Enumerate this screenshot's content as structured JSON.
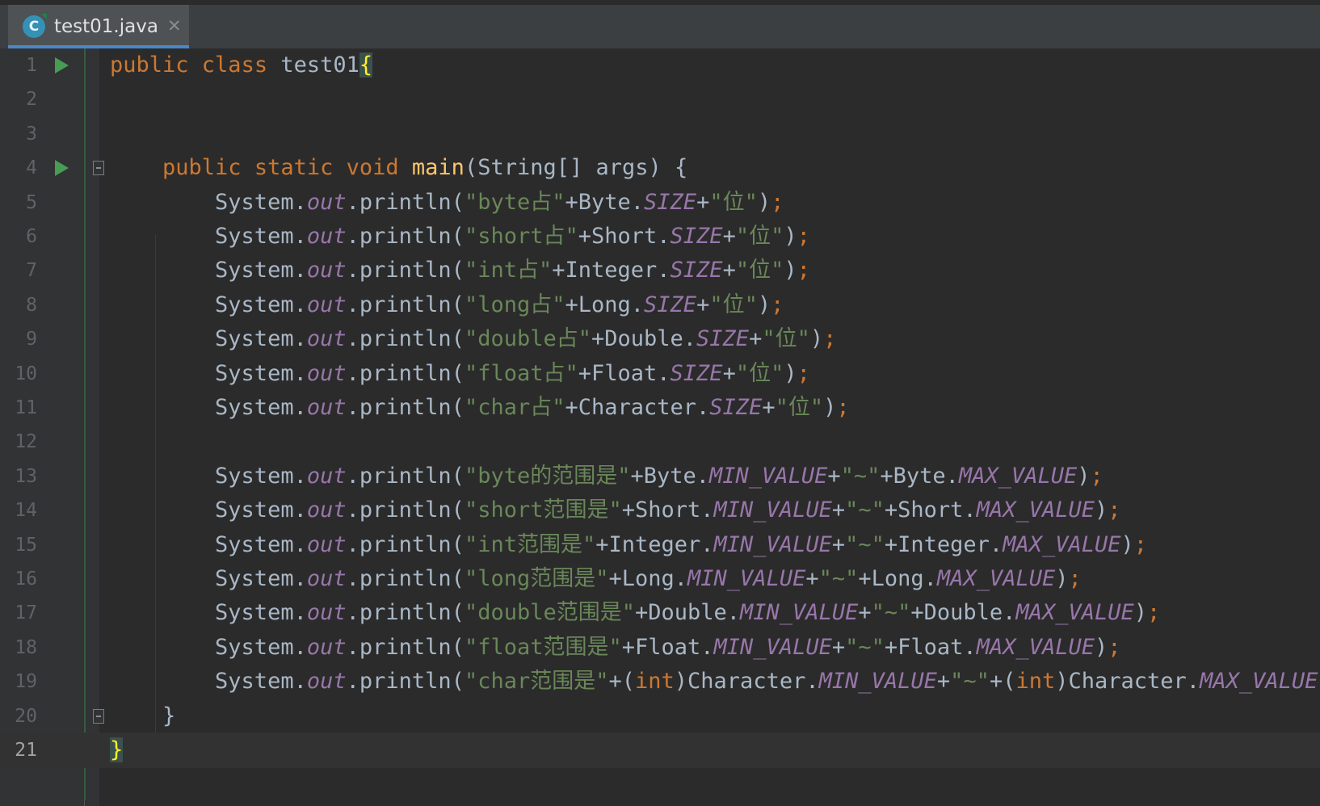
{
  "tab": {
    "icon": "class-file-icon",
    "icon_letter": "C",
    "file_name": "test01.java",
    "close_glyph": "✕"
  },
  "editor": {
    "current_line": 21,
    "lines": [
      {
        "n": "1",
        "run": true,
        "tokens": [
          [
            "kw",
            "public "
          ],
          [
            "kw",
            "class "
          ],
          [
            "p",
            "test01"
          ],
          [
            "brace",
            "{"
          ]
        ]
      },
      {
        "n": "2",
        "tokens": []
      },
      {
        "n": "3",
        "tokens": []
      },
      {
        "n": "4",
        "run": true,
        "fold": true,
        "tokens": [
          [
            "p",
            "    "
          ],
          [
            "kw",
            "public "
          ],
          [
            "kw",
            "static "
          ],
          [
            "kw",
            "void "
          ],
          [
            "fn",
            "main"
          ],
          [
            "p",
            "(String[] args) {"
          ]
        ]
      },
      {
        "n": "5",
        "tokens": [
          [
            "p",
            "        System."
          ],
          [
            "fld",
            "out"
          ],
          [
            "p",
            ".println("
          ],
          [
            "str",
            "\"byte占\""
          ],
          [
            "p",
            "+Byte."
          ],
          [
            "fld",
            "SIZE"
          ],
          [
            "p",
            "+"
          ],
          [
            "str",
            "\"位\""
          ],
          [
            "p",
            ")"
          ],
          [
            "kw",
            ";"
          ]
        ]
      },
      {
        "n": "6",
        "tokens": [
          [
            "p",
            "        System."
          ],
          [
            "fld",
            "out"
          ],
          [
            "p",
            ".println("
          ],
          [
            "str",
            "\"short占\""
          ],
          [
            "p",
            "+Short."
          ],
          [
            "fld",
            "SIZE"
          ],
          [
            "p",
            "+"
          ],
          [
            "str",
            "\"位\""
          ],
          [
            "p",
            ")"
          ],
          [
            "kw",
            ";"
          ]
        ]
      },
      {
        "n": "7",
        "tokens": [
          [
            "p",
            "        System."
          ],
          [
            "fld",
            "out"
          ],
          [
            "p",
            ".println("
          ],
          [
            "str",
            "\"int占\""
          ],
          [
            "p",
            "+Integer."
          ],
          [
            "fld",
            "SIZE"
          ],
          [
            "p",
            "+"
          ],
          [
            "str",
            "\"位\""
          ],
          [
            "p",
            ")"
          ],
          [
            "kw",
            ";"
          ]
        ]
      },
      {
        "n": "8",
        "tokens": [
          [
            "p",
            "        System."
          ],
          [
            "fld",
            "out"
          ],
          [
            "p",
            ".println("
          ],
          [
            "str",
            "\"long占\""
          ],
          [
            "p",
            "+Long."
          ],
          [
            "fld",
            "SIZE"
          ],
          [
            "p",
            "+"
          ],
          [
            "str",
            "\"位\""
          ],
          [
            "p",
            ")"
          ],
          [
            "kw",
            ";"
          ]
        ]
      },
      {
        "n": "9",
        "tokens": [
          [
            "p",
            "        System."
          ],
          [
            "fld",
            "out"
          ],
          [
            "p",
            ".println("
          ],
          [
            "str",
            "\"double占\""
          ],
          [
            "p",
            "+Double."
          ],
          [
            "fld",
            "SIZE"
          ],
          [
            "p",
            "+"
          ],
          [
            "str",
            "\"位\""
          ],
          [
            "p",
            ")"
          ],
          [
            "kw",
            ";"
          ]
        ]
      },
      {
        "n": "10",
        "tokens": [
          [
            "p",
            "        System."
          ],
          [
            "fld",
            "out"
          ],
          [
            "p",
            ".println("
          ],
          [
            "str",
            "\"float占\""
          ],
          [
            "p",
            "+Float."
          ],
          [
            "fld",
            "SIZE"
          ],
          [
            "p",
            "+"
          ],
          [
            "str",
            "\"位\""
          ],
          [
            "p",
            ")"
          ],
          [
            "kw",
            ";"
          ]
        ]
      },
      {
        "n": "11",
        "tokens": [
          [
            "p",
            "        System."
          ],
          [
            "fld",
            "out"
          ],
          [
            "p",
            ".println("
          ],
          [
            "str",
            "\"char占\""
          ],
          [
            "p",
            "+Character."
          ],
          [
            "fld",
            "SIZE"
          ],
          [
            "p",
            "+"
          ],
          [
            "str",
            "\"位\""
          ],
          [
            "p",
            ")"
          ],
          [
            "kw",
            ";"
          ]
        ]
      },
      {
        "n": "12",
        "tokens": []
      },
      {
        "n": "13",
        "tokens": [
          [
            "p",
            "        System."
          ],
          [
            "fld",
            "out"
          ],
          [
            "p",
            ".println("
          ],
          [
            "str",
            "\"byte的范围是\""
          ],
          [
            "p",
            "+Byte."
          ],
          [
            "fld",
            "MIN_VALUE"
          ],
          [
            "p",
            "+"
          ],
          [
            "str",
            "\"~\""
          ],
          [
            "p",
            "+Byte."
          ],
          [
            "fld",
            "MAX_VALUE"
          ],
          [
            "p",
            ")"
          ],
          [
            "kw",
            ";"
          ]
        ]
      },
      {
        "n": "14",
        "tokens": [
          [
            "p",
            "        System."
          ],
          [
            "fld",
            "out"
          ],
          [
            "p",
            ".println("
          ],
          [
            "str",
            "\"short范围是\""
          ],
          [
            "p",
            "+Short."
          ],
          [
            "fld",
            "MIN_VALUE"
          ],
          [
            "p",
            "+"
          ],
          [
            "str",
            "\"~\""
          ],
          [
            "p",
            "+Short."
          ],
          [
            "fld",
            "MAX_VALUE"
          ],
          [
            "p",
            ")"
          ],
          [
            "kw",
            ";"
          ]
        ]
      },
      {
        "n": "15",
        "tokens": [
          [
            "p",
            "        System."
          ],
          [
            "fld",
            "out"
          ],
          [
            "p",
            ".println("
          ],
          [
            "str",
            "\"int范围是\""
          ],
          [
            "p",
            "+Integer."
          ],
          [
            "fld",
            "MIN_VALUE"
          ],
          [
            "p",
            "+"
          ],
          [
            "str",
            "\"~\""
          ],
          [
            "p",
            "+Integer."
          ],
          [
            "fld",
            "MAX_VALUE"
          ],
          [
            "p",
            ")"
          ],
          [
            "kw",
            ";"
          ]
        ]
      },
      {
        "n": "16",
        "tokens": [
          [
            "p",
            "        System."
          ],
          [
            "fld",
            "out"
          ],
          [
            "p",
            ".println("
          ],
          [
            "str",
            "\"long范围是\""
          ],
          [
            "p",
            "+Long."
          ],
          [
            "fld",
            "MIN_VALUE"
          ],
          [
            "p",
            "+"
          ],
          [
            "str",
            "\"~\""
          ],
          [
            "p",
            "+Long."
          ],
          [
            "fld",
            "MAX_VALUE"
          ],
          [
            "p",
            ")"
          ],
          [
            "kw",
            ";"
          ]
        ]
      },
      {
        "n": "17",
        "tokens": [
          [
            "p",
            "        System."
          ],
          [
            "fld",
            "out"
          ],
          [
            "p",
            ".println("
          ],
          [
            "str",
            "\"double范围是\""
          ],
          [
            "p",
            "+Double."
          ],
          [
            "fld",
            "MIN_VALUE"
          ],
          [
            "p",
            "+"
          ],
          [
            "str",
            "\"~\""
          ],
          [
            "p",
            "+Double."
          ],
          [
            "fld",
            "MAX_VALUE"
          ],
          [
            "p",
            ")"
          ],
          [
            "kw",
            ";"
          ]
        ]
      },
      {
        "n": "18",
        "tokens": [
          [
            "p",
            "        System."
          ],
          [
            "fld",
            "out"
          ],
          [
            "p",
            ".println("
          ],
          [
            "str",
            "\"float范围是\""
          ],
          [
            "p",
            "+Float."
          ],
          [
            "fld",
            "MIN_VALUE"
          ],
          [
            "p",
            "+"
          ],
          [
            "str",
            "\"~\""
          ],
          [
            "p",
            "+Float."
          ],
          [
            "fld",
            "MAX_VALUE"
          ],
          [
            "p",
            ")"
          ],
          [
            "kw",
            ";"
          ]
        ]
      },
      {
        "n": "19",
        "tokens": [
          [
            "p",
            "        System."
          ],
          [
            "fld",
            "out"
          ],
          [
            "p",
            ".println("
          ],
          [
            "str",
            "\"char范围是\""
          ],
          [
            "p",
            "+("
          ],
          [
            "kw",
            "int"
          ],
          [
            "p",
            ")Character."
          ],
          [
            "fld",
            "MIN_VALUE"
          ],
          [
            "p",
            "+"
          ],
          [
            "str",
            "\"~\""
          ],
          [
            "p",
            "+("
          ],
          [
            "kw",
            "int"
          ],
          [
            "p",
            ")Character."
          ],
          [
            "fld",
            "MAX_VALUE"
          ],
          [
            "p",
            ")"
          ],
          [
            "kw",
            ";"
          ]
        ]
      },
      {
        "n": "20",
        "fold": true,
        "tokens": [
          [
            "p",
            "    }"
          ]
        ]
      },
      {
        "n": "21",
        "tokens": [
          [
            "brace",
            "}"
          ]
        ]
      }
    ]
  }
}
